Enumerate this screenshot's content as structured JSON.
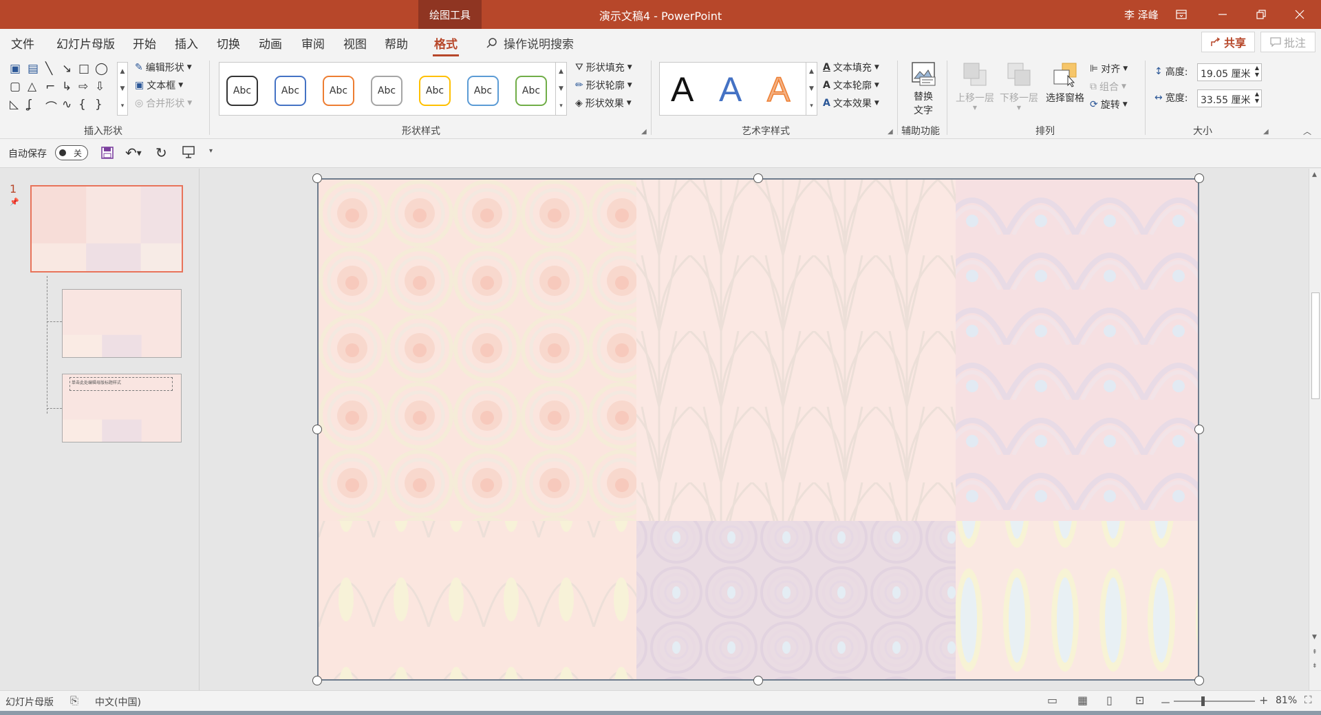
{
  "titlebar": {
    "context_tab": "绘图工具",
    "title": "演示文稿4  -  PowerPoint",
    "user": "李 泽峰",
    "ribbon_display_icon": "ribbon-display-icon",
    "minimize_icon": "minimize-icon",
    "restore_icon": "restore-icon",
    "close_icon": "close-icon"
  },
  "tabs": [
    {
      "label": "文件"
    },
    {
      "label": "幻灯片母版"
    },
    {
      "label": "开始"
    },
    {
      "label": "插入"
    },
    {
      "label": "切换"
    },
    {
      "label": "动画"
    },
    {
      "label": "审阅"
    },
    {
      "label": "视图"
    },
    {
      "label": "帮助"
    },
    {
      "label": "格式"
    }
  ],
  "search": {
    "label": "操作说明搜索"
  },
  "share": {
    "label": "共享"
  },
  "comments": {
    "label": "批注"
  },
  "ribbon": {
    "insert_shapes": {
      "label": "插入形状",
      "edit_shape": "编辑形状",
      "text_box": "文本框",
      "merge_shapes": "合并形状"
    },
    "shape_styles": {
      "label": "形状样式",
      "gallery": [
        {
          "text": "Abc",
          "color": "#333333"
        },
        {
          "text": "Abc",
          "color": "#4472c4"
        },
        {
          "text": "Abc",
          "color": "#ed7d31"
        },
        {
          "text": "Abc",
          "color": "#a5a5a5"
        },
        {
          "text": "Abc",
          "color": "#ffc000"
        },
        {
          "text": "Abc",
          "color": "#5b9bd5"
        },
        {
          "text": "Abc",
          "color": "#70ad47"
        }
      ],
      "fill": "形状填充",
      "outline": "形状轮廓",
      "effects": "形状效果"
    },
    "wordart_styles": {
      "label": "艺术字样式",
      "gallery": [
        {
          "text": "A",
          "color": "#111111"
        },
        {
          "text": "A",
          "color": "#4472c4"
        },
        {
          "text": "A",
          "color": "#ed7d31"
        }
      ],
      "text_fill": "文本填充",
      "text_outline": "文本轮廓",
      "text_effects": "文本效果"
    },
    "accessibility": {
      "label": "辅助功能",
      "alt_text_line1": "替换",
      "alt_text_line2": "文字"
    },
    "arrange": {
      "label": "排列",
      "bring_forward": "上移一层",
      "send_backward": "下移一层",
      "selection_pane": "选择窗格",
      "align": "对齐",
      "group": "组合",
      "rotate": "旋转"
    },
    "size": {
      "label": "大小",
      "height_label": "高度:",
      "height_value": "19.05 厘米",
      "width_label": "宽度:",
      "width_value": "33.55 厘米"
    }
  },
  "qat": {
    "autosave_label": "自动保存",
    "autosave_state": "关"
  },
  "slides_pane": {
    "slide_number": "1",
    "layout_text": "单击此处编辑母版标题样式"
  },
  "statusbar": {
    "view_mode": "幻灯片母版",
    "language": "中文(中国)",
    "zoom_minus": "－",
    "zoom_plus": "+",
    "zoom": "81%"
  },
  "colors": {
    "accent": "#b7472a",
    "title_bar": "#b7472a",
    "context_tab": "#8f3522",
    "slide_selected_border": "#e8735a"
  }
}
